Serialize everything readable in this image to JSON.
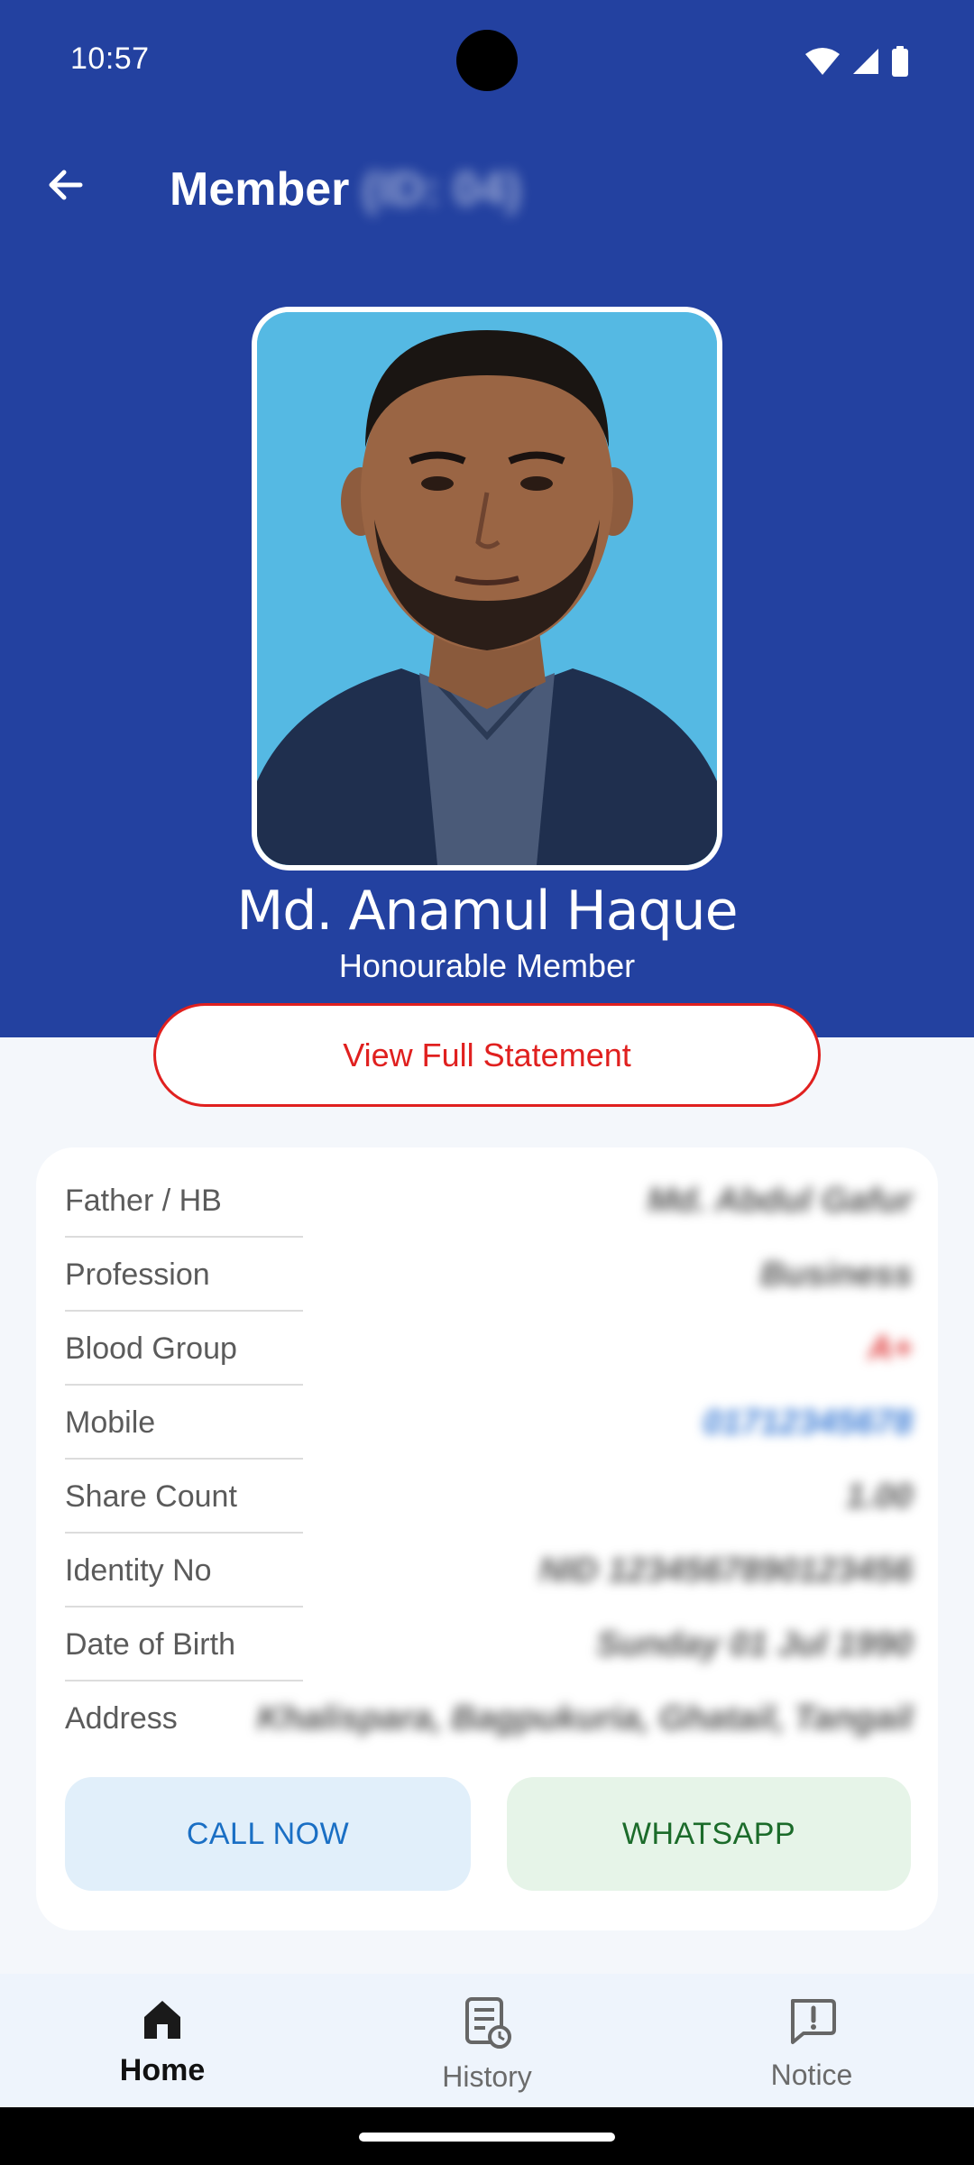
{
  "status_bar": {
    "time": "10:57",
    "icons": [
      "wifi-icon",
      "signal-icon",
      "battery-icon"
    ]
  },
  "app_bar": {
    "title": "Member",
    "member_id": "(ID: 04)",
    "back_icon": "arrow-left-icon"
  },
  "profile": {
    "name": "Md. Anamul Haque",
    "role": "Honourable Member"
  },
  "statement_button": {
    "label": "View Full Statement"
  },
  "info": {
    "rows": [
      {
        "label": "Father / HB",
        "value": "Md. Abdul Gafur"
      },
      {
        "label": "Profession",
        "value": "Business"
      },
      {
        "label": "Blood Group",
        "value": "A+"
      },
      {
        "label": "Mobile",
        "value": "01712345678"
      },
      {
        "label": "Share Count",
        "value": "1.00"
      },
      {
        "label": "Identity No",
        "value": "NID 1234567890123456"
      },
      {
        "label": "Date of Birth",
        "value": "Sunday 01 Jul 1990"
      },
      {
        "label": "Address",
        "value": "Khalispara, Bagpukuria, Ghatail, Tangail"
      }
    ]
  },
  "actions": {
    "call_label": "CALL NOW",
    "whatsapp_label": "WHATSAPP"
  },
  "bottom_nav": {
    "items": [
      {
        "label": "Home",
        "icon": "home-icon",
        "active": true
      },
      {
        "label": "History",
        "icon": "history-icon",
        "active": false
      },
      {
        "label": "Notice",
        "icon": "notice-icon",
        "active": false
      }
    ]
  },
  "colors": {
    "header_bg": "#2341a0",
    "accent_red": "#e0201f",
    "call_bg": "#e1effa",
    "whatsapp_bg": "#e6f4e8"
  }
}
